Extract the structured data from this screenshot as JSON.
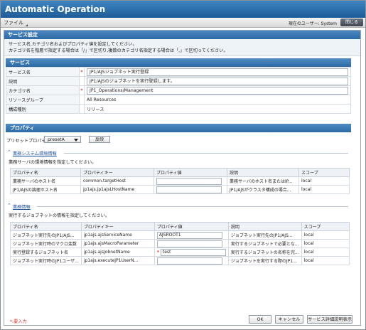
{
  "app": {
    "title": "Automatic Operation"
  },
  "menubar": {
    "file": "ファイル",
    "user_label": "現在のユーザー: System",
    "close": "閉じる"
  },
  "dialog": {
    "title": "サービス設定",
    "intro_line1": "サービス名,カテゴリ名およびプロパティ値を設定してください。",
    "intro_line2": "カテゴリ名を階層で指定する場合は「/」で区切り,複数のカテゴリ名指定する場合は「,」で区切ってください。"
  },
  "service": {
    "heading": "サービス",
    "rows": [
      {
        "label": "サービス名",
        "required": "*",
        "value": "JP1/AJSジョブネット実行登録"
      },
      {
        "label": "説明",
        "required": "",
        "value": "JP1/AJSのジョブネットを実行登録します。"
      },
      {
        "label": "カテゴリ名",
        "required": "*",
        "value": "JP1_Operations/Management"
      },
      {
        "label": "リソースグループ",
        "required": "",
        "value": "All Resources"
      },
      {
        "label": "構成種別",
        "required": "",
        "value": "リリース"
      }
    ]
  },
  "properties": {
    "heading": "プロパティ",
    "preset_label": "プリセットプロパティ",
    "preset_value": "presetA",
    "apply_button": "反映",
    "columns": [
      "プロパティ名",
      "プロパティキー",
      "プロパティ値",
      "説明",
      "スコープ"
    ],
    "group1": {
      "title": "業務システム環境情報",
      "desc": "業務サーバの環境情報を指定してください。",
      "rows": [
        {
          "name": "業務サーバのホスト名",
          "key": "common.targetHost",
          "required": "",
          "value": "",
          "desc": "業務サーバのホスト名またはIP...",
          "scope": "local"
        },
        {
          "name": "JP1/AJSの論理ホスト名",
          "key": "jp1ajs.jp1ajsLHostName",
          "required": "",
          "value": "",
          "desc": "JP1/AJSがクラスタ構成の場合...",
          "scope": "local"
        }
      ]
    },
    "group2": {
      "title": "業務情報",
      "desc": "実行するジョブネットの情報を指定してください。",
      "rows": [
        {
          "name": "ジョブネット実行先のJP1/AJS...",
          "key": "jp1ajs.ajsServiceName",
          "required": "",
          "value": "AJSROOT1",
          "desc": "ジョブネット実行先のJP1/AJS...",
          "scope": "local"
        },
        {
          "name": "ジョブネット実行時のマクロ変数",
          "key": "jp1ajs.ajsMacroParameter",
          "required": "",
          "value": "",
          "desc": "実行するジョブネットで必要とな...",
          "scope": "local"
        },
        {
          "name": "実行登録するジョブネット名",
          "key": "jp1ajs.ajsJobnetName",
          "required": "*",
          "value": "test",
          "desc": "実行するジョブネットの名称を完...",
          "scope": "local"
        },
        {
          "name": "ジョブネット実行時のJP1ユーザ...",
          "key": "jp1ajs.executeJP1UserN...",
          "required": "",
          "value": "",
          "desc": "ジョブネットを実行する際のJP1...",
          "scope": "local"
        }
      ]
    }
  },
  "footer": {
    "required_note": "*:要入力",
    "ok": "OK",
    "cancel": "キャンセル",
    "detail": "サービス詳細説明表示"
  },
  "colors": {
    "title_bar": "#1d5b96",
    "section_header": "#2c6aa6",
    "required": "#d9342b"
  }
}
